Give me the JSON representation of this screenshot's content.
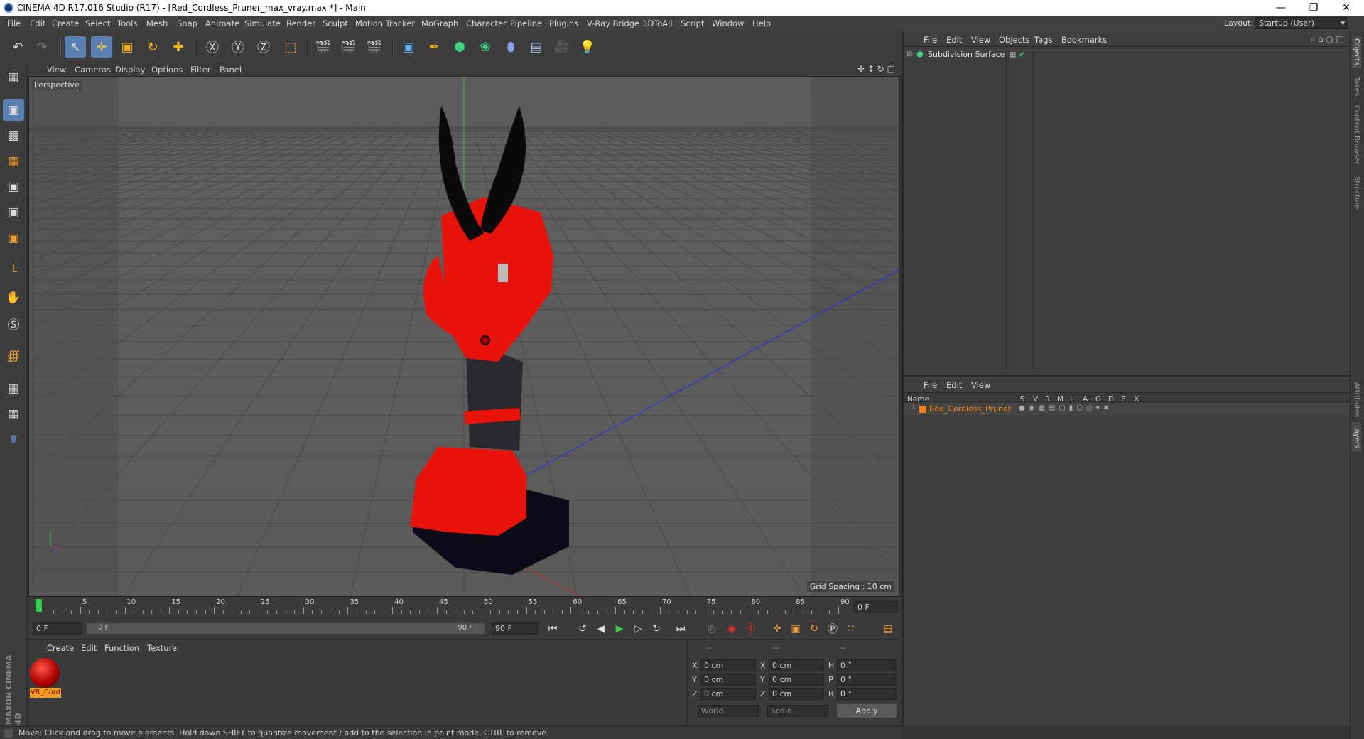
{
  "window": {
    "title": "CINEMA 4D R17.016 Studio (R17) - [Red_Cordless_Pruner_max_vray.max *] - Main",
    "controls": [
      "—",
      "❐",
      "✕"
    ]
  },
  "menubar": {
    "items": [
      "File",
      "Edit",
      "Create",
      "Select",
      "Tools",
      "Mesh",
      "Snap",
      "Animate",
      "Simulate",
      "Render",
      "Sculpt",
      "Motion Tracker",
      "MoGraph",
      "Character",
      "Pipeline",
      "Plugins",
      "V-Ray Bridge",
      "3DToAll",
      "Script",
      "Window",
      "Help"
    ],
    "layout_label": "Layout:",
    "layout_value": "Startup (User)"
  },
  "viewport": {
    "menu": [
      "View",
      "Cameras",
      "Display",
      "Options",
      "Filter",
      "Panel"
    ],
    "label": "Perspective",
    "grid_spacing": "Grid Spacing : 10 cm"
  },
  "timeline": {
    "ticks": [
      "0",
      "5",
      "10",
      "15",
      "20",
      "25",
      "30",
      "35",
      "40",
      "45",
      "50",
      "55",
      "60",
      "65",
      "70",
      "75",
      "80",
      "85",
      "90"
    ],
    "current_frame": "0 F",
    "start_field": "0 F",
    "range_start": "0 F",
    "range_end": "90 F",
    "end_field": "90 F"
  },
  "material_panel": {
    "menu": [
      "Create",
      "Edit",
      "Function",
      "Texture"
    ],
    "material_name": "VR_Cord"
  },
  "coords": {
    "headers": [
      "--",
      "--",
      "--"
    ],
    "rows": [
      {
        "a": "X",
        "pos": "0 cm",
        "b": "X",
        "size": "0 cm",
        "c": "H",
        "rot": "0 °"
      },
      {
        "a": "Y",
        "pos": "0 cm",
        "b": "Y",
        "size": "0 cm",
        "c": "P",
        "rot": "0 °"
      },
      {
        "a": "Z",
        "pos": "0 cm",
        "b": "Z",
        "size": "0 cm",
        "c": "B",
        "rot": "0 °"
      }
    ],
    "mode_world": "World",
    "mode_scale": "Scale",
    "apply": "Apply"
  },
  "status": "Move: Click and drag to move elements. Hold down SHIFT to quantize movement / add to the selection in point mode, CTRL to remove.",
  "objects_panel": {
    "menu": [
      "File",
      "Edit",
      "View",
      "Objects",
      "Tags",
      "Bookmarks"
    ],
    "object": "Subdivision Surface"
  },
  "layers_panel": {
    "menu": [
      "File",
      "Edit",
      "View"
    ],
    "col_name": "Name",
    "cols": [
      "S",
      "V",
      "R",
      "M",
      "L",
      "A",
      "G",
      "D",
      "E",
      "X"
    ],
    "layer": "Red_Cordless_Pruner"
  },
  "right_tabs": [
    "Objects",
    "Takes",
    "Content Browser",
    "Structure",
    "Attributes",
    "Layers"
  ],
  "brand": "MAXON CINEMA 4D",
  "colors": {
    "accent": "#5a7fb3",
    "layer_orange": "#f0831e",
    "pruner_red": "#e8140c"
  }
}
